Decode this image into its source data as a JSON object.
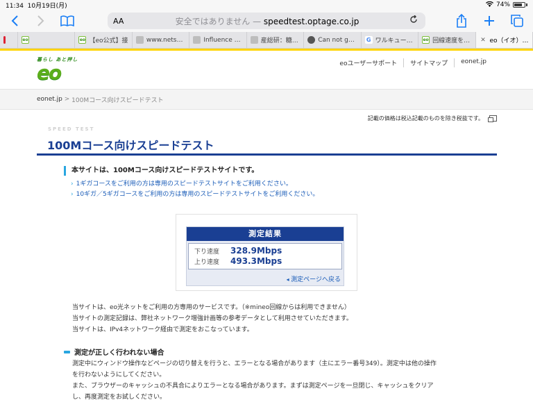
{
  "status_bar": {
    "time": "11:34",
    "date": "10月19日(月)",
    "battery": "74%"
  },
  "browser": {
    "aa_label": "AA",
    "address_prefix": "安全ではありません — ",
    "address_domain": "speedtest.optage.co.jp",
    "tabs": [
      {
        "title": "",
        "favicon": "red-bookmark"
      },
      {
        "title": "",
        "favicon": "eo"
      },
      {
        "title": "【eo公式】接",
        "favicon": "eo"
      },
      {
        "title": "www.netsu....",
        "favicon": "gray"
      },
      {
        "title": "Influence of...",
        "favicon": "gray"
      },
      {
        "title": "産総研：糖鎖...",
        "favicon": "gray"
      },
      {
        "title": "Can not get...",
        "favicon": "wordpress"
      },
      {
        "title": "ワルキューレ...",
        "favicon": "google"
      },
      {
        "title": "回線速度を計...",
        "favicon": "eo"
      },
      {
        "title": "eo（イオ）|...",
        "favicon": "close",
        "active": true
      }
    ]
  },
  "site": {
    "logo_tagline": "暮らし あと押し",
    "logo_mark": "eo",
    "header_links": [
      "eoユーザーサポート",
      "サイトマップ",
      "eonet.jp"
    ],
    "breadcrumb_home": "eonet.jp",
    "breadcrumb_sep": " > ",
    "breadcrumb_current": "100Mコース向けスピードテスト",
    "tax_note": "記載の価格は税込記載のものを除き税抜です。",
    "eyebrow": "SPEED TEST",
    "page_title": "100Mコース向けスピードテスト"
  },
  "notice": {
    "heading": "本サイトは、100Mコース向けスピードテストサイトです。",
    "links": [
      "1ギガコースをご利用の方は専用のスピードテストサイトをご利用ください。",
      "10ギガ／5ギガコースをご利用の方は専用のスピードテストサイトをご利用ください。"
    ]
  },
  "result": {
    "heading": "測定結果",
    "down_label": "下り速度",
    "down_value": "328.9Mbps",
    "up_label": "上り速度",
    "up_value": "493.3Mbps",
    "back_link": "測定ページへ戻る"
  },
  "info_lines": [
    "当サイトは、eo光ネットをご利用の方専用のサービスです。（※mineo回線からは利用できません）",
    "当サイトの測定記録は、弊社ネットワーク増強計画等の参考データとして利用させていただきます。",
    "当サイトは、IPv4ネットワーク経由で測定をおこなっています。"
  ],
  "trouble": {
    "heading": "測定が正しく行われない場合",
    "lines": [
      "測定中にウィンドウ操作などページの切り替えを行うと、エラーとなる場合があります（主にエラー番号349）。測定中は他の操作",
      "を行わないようにしてください。",
      "また、ブラウザーのキャッシュの不具合によりエラーとなる場合があります。まずは測定ページを一旦閉じ、キャッシュをクリア",
      "し、再度測定をお試しください。"
    ]
  },
  "colors": {
    "brand_blue": "#1a3f93",
    "accent_cyan": "#29a6e0",
    "top_yellow": "#ffd400",
    "link_blue": "#1a5cb8",
    "eo_green": "#5cae1c"
  }
}
